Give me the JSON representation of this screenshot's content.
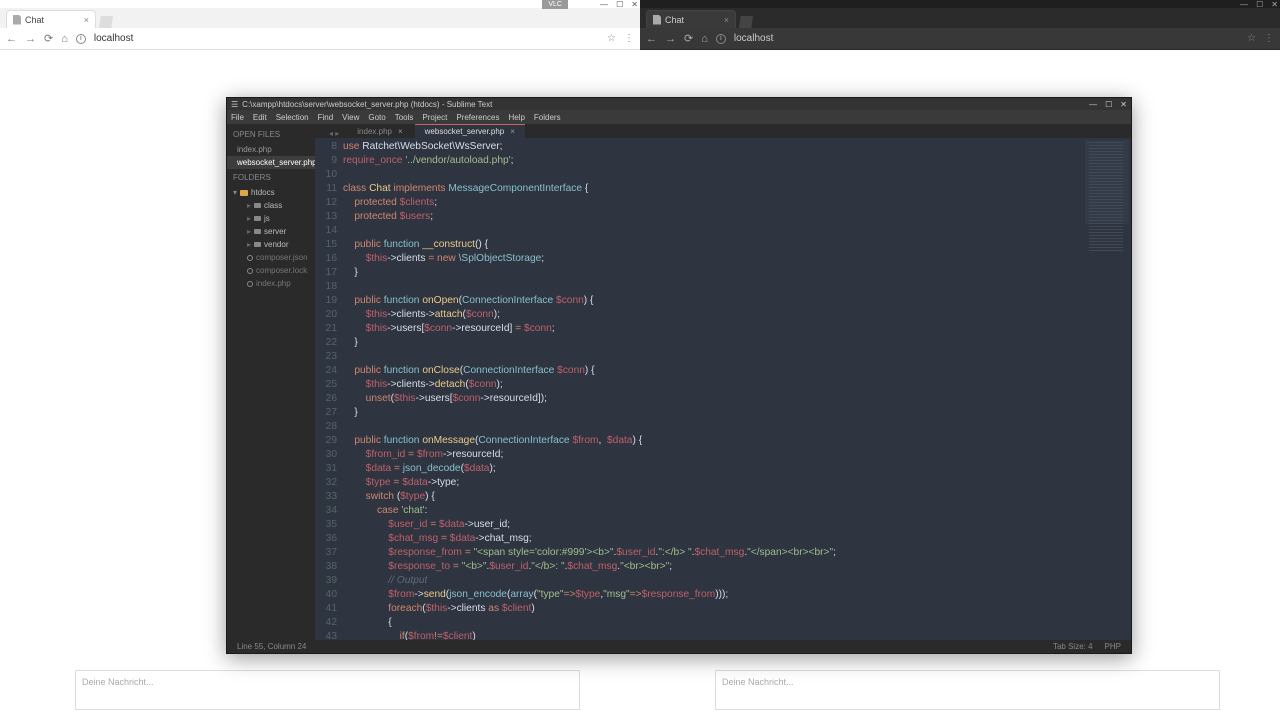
{
  "browserLeft": {
    "tabTitle": "Chat",
    "url": "localhost",
    "vscLabel": "VLC",
    "chatPlaceholder": "Deine Nachricht..."
  },
  "browserRight": {
    "tabTitle": "Chat",
    "url": "localhost",
    "chatPlaceholder": "Deine Nachricht..."
  },
  "editor": {
    "titlebar": "C:\\xampp\\htdocs\\server\\websocket_server.php (htdocs) - Sublime Text",
    "menu": [
      "File",
      "Edit",
      "Selection",
      "Find",
      "View",
      "Goto",
      "Tools",
      "Project",
      "Preferences",
      "Help",
      "Folders"
    ],
    "sidebar": {
      "openFiles": "OPEN FILES",
      "files": [
        "index.php",
        "websocket_server.php"
      ],
      "foldersLabel": "FOLDERS",
      "root": "htdocs",
      "subfolders": [
        "class",
        "js",
        "server",
        "vendor"
      ],
      "loosefiles": [
        "composer.json",
        "composer.lock",
        "index.php"
      ]
    },
    "tabs": [
      "index.php",
      "websocket_server.php"
    ],
    "status": {
      "left": "Line 55, Column 24",
      "tab": "Tab Size: 4",
      "lang": "PHP"
    },
    "lineStart": 8,
    "code": [
      {
        "indent": 0,
        "tokens": [
          [
            "k-orange",
            "use"
          ],
          [
            "",
            " Ratchet\\WebSocket\\WsServer"
          ],
          [
            "punct",
            ";"
          ]
        ]
      },
      {
        "indent": 0,
        "tokens": [
          [
            "k-red",
            "require_once"
          ],
          [
            "",
            " "
          ],
          [
            "k-green",
            "'../vendor/autoload.php'"
          ],
          [
            "punct",
            ";"
          ]
        ]
      },
      {
        "indent": 0,
        "tokens": []
      },
      {
        "indent": 0,
        "tokens": [
          [
            "k-orange",
            "class"
          ],
          [
            "",
            " "
          ],
          [
            "k-yellow",
            "Chat"
          ],
          [
            "",
            " "
          ],
          [
            "k-orange",
            "implements"
          ],
          [
            "",
            " "
          ],
          [
            "k-cyan",
            "MessageComponentInterface"
          ],
          [
            "",
            " "
          ],
          [
            "punct",
            "{"
          ]
        ]
      },
      {
        "indent": 1,
        "tokens": [
          [
            "k-orange",
            "protected"
          ],
          [
            "",
            " "
          ],
          [
            "k-red",
            "$clients"
          ],
          [
            "punct",
            ";"
          ]
        ]
      },
      {
        "indent": 1,
        "tokens": [
          [
            "k-orange",
            "protected"
          ],
          [
            "",
            " "
          ],
          [
            "k-red",
            "$users"
          ],
          [
            "punct",
            ";"
          ]
        ]
      },
      {
        "indent": 0,
        "tokens": []
      },
      {
        "indent": 1,
        "tokens": [
          [
            "k-orange",
            "public"
          ],
          [
            "",
            " "
          ],
          [
            "k-cyan",
            "function"
          ],
          [
            "",
            " "
          ],
          [
            "k-yellow",
            "__construct"
          ],
          [
            "punct",
            "() {"
          ]
        ]
      },
      {
        "indent": 2,
        "tokens": [
          [
            "k-red",
            "$this"
          ],
          [
            "punct",
            "->"
          ],
          [
            "",
            "clients"
          ],
          [
            "",
            " "
          ],
          [
            "k-orange",
            "="
          ],
          [
            "",
            " "
          ],
          [
            "k-orange",
            "new"
          ],
          [
            "",
            " "
          ],
          [
            "k-cyan",
            "\\SplObjectStorage"
          ],
          [
            "punct",
            ";"
          ]
        ]
      },
      {
        "indent": 1,
        "tokens": [
          [
            "punct",
            "}"
          ]
        ]
      },
      {
        "indent": 0,
        "tokens": []
      },
      {
        "indent": 1,
        "tokens": [
          [
            "k-orange",
            "public"
          ],
          [
            "",
            " "
          ],
          [
            "k-cyan",
            "function"
          ],
          [
            "",
            " "
          ],
          [
            "k-yellow",
            "onOpen"
          ],
          [
            "punct",
            "("
          ],
          [
            "k-cyan",
            "ConnectionInterface"
          ],
          [
            "",
            " "
          ],
          [
            "k-red",
            "$conn"
          ],
          [
            "punct",
            ") {"
          ]
        ]
      },
      {
        "indent": 2,
        "tokens": [
          [
            "k-red",
            "$this"
          ],
          [
            "punct",
            "->"
          ],
          [
            "",
            "clients"
          ],
          [
            "punct",
            "->"
          ],
          [
            "k-yellow",
            "attach"
          ],
          [
            "punct",
            "("
          ],
          [
            "k-red",
            "$conn"
          ],
          [
            "punct",
            ");"
          ]
        ]
      },
      {
        "indent": 2,
        "tokens": [
          [
            "k-red",
            "$this"
          ],
          [
            "punct",
            "->"
          ],
          [
            "",
            "users"
          ],
          [
            "punct",
            "["
          ],
          [
            "k-red",
            "$conn"
          ],
          [
            "punct",
            "->"
          ],
          [
            "",
            "resourceId"
          ],
          [
            "punct",
            "]"
          ],
          [
            "",
            " "
          ],
          [
            "k-orange",
            "="
          ],
          [
            "",
            " "
          ],
          [
            "k-red",
            "$conn"
          ],
          [
            "punct",
            ";"
          ]
        ]
      },
      {
        "indent": 1,
        "tokens": [
          [
            "punct",
            "}"
          ]
        ]
      },
      {
        "indent": 0,
        "tokens": []
      },
      {
        "indent": 1,
        "tokens": [
          [
            "k-orange",
            "public"
          ],
          [
            "",
            " "
          ],
          [
            "k-cyan",
            "function"
          ],
          [
            "",
            " "
          ],
          [
            "k-yellow",
            "onClose"
          ],
          [
            "punct",
            "("
          ],
          [
            "k-cyan",
            "ConnectionInterface"
          ],
          [
            "",
            " "
          ],
          [
            "k-red",
            "$conn"
          ],
          [
            "punct",
            ") {"
          ]
        ]
      },
      {
        "indent": 2,
        "tokens": [
          [
            "k-red",
            "$this"
          ],
          [
            "punct",
            "->"
          ],
          [
            "",
            "clients"
          ],
          [
            "punct",
            "->"
          ],
          [
            "k-yellow",
            "detach"
          ],
          [
            "punct",
            "("
          ],
          [
            "k-red",
            "$conn"
          ],
          [
            "punct",
            ");"
          ]
        ]
      },
      {
        "indent": 2,
        "tokens": [
          [
            "k-orange",
            "unset"
          ],
          [
            "punct",
            "("
          ],
          [
            "k-red",
            "$this"
          ],
          [
            "punct",
            "->"
          ],
          [
            "",
            "users"
          ],
          [
            "punct",
            "["
          ],
          [
            "k-red",
            "$conn"
          ],
          [
            "punct",
            "->"
          ],
          [
            "",
            "resourceId"
          ],
          [
            "punct",
            "]);"
          ]
        ]
      },
      {
        "indent": 1,
        "tokens": [
          [
            "punct",
            "}"
          ]
        ]
      },
      {
        "indent": 0,
        "tokens": []
      },
      {
        "indent": 1,
        "tokens": [
          [
            "k-orange",
            "public"
          ],
          [
            "",
            " "
          ],
          [
            "k-cyan",
            "function"
          ],
          [
            "",
            " "
          ],
          [
            "k-yellow",
            "onMessage"
          ],
          [
            "punct",
            "("
          ],
          [
            "k-cyan",
            "ConnectionInterface"
          ],
          [
            "",
            " "
          ],
          [
            "k-red",
            "$from"
          ],
          [
            "punct",
            ",  "
          ],
          [
            "k-red",
            "$data"
          ],
          [
            "punct",
            ") {"
          ]
        ]
      },
      {
        "indent": 2,
        "tokens": [
          [
            "k-red",
            "$from_id"
          ],
          [
            "",
            " "
          ],
          [
            "k-orange",
            "="
          ],
          [
            "",
            " "
          ],
          [
            "k-red",
            "$from"
          ],
          [
            "punct",
            "->"
          ],
          [
            "",
            "resourceId"
          ],
          [
            "punct",
            ";"
          ]
        ]
      },
      {
        "indent": 2,
        "tokens": [
          [
            "k-red",
            "$data"
          ],
          [
            "",
            " "
          ],
          [
            "k-orange",
            "="
          ],
          [
            "",
            " "
          ],
          [
            "k-cyan",
            "json_decode"
          ],
          [
            "punct",
            "("
          ],
          [
            "k-red",
            "$data"
          ],
          [
            "punct",
            ");"
          ]
        ]
      },
      {
        "indent": 2,
        "tokens": [
          [
            "k-red",
            "$type"
          ],
          [
            "",
            " "
          ],
          [
            "k-orange",
            "="
          ],
          [
            "",
            " "
          ],
          [
            "k-red",
            "$data"
          ],
          [
            "punct",
            "->"
          ],
          [
            "",
            "type"
          ],
          [
            "punct",
            ";"
          ]
        ]
      },
      {
        "indent": 2,
        "tokens": [
          [
            "k-orange",
            "switch"
          ],
          [
            "",
            " "
          ],
          [
            "punct",
            "("
          ],
          [
            "k-red",
            "$type"
          ],
          [
            "punct",
            ") {"
          ]
        ]
      },
      {
        "indent": 3,
        "tokens": [
          [
            "k-orange",
            "case"
          ],
          [
            "",
            " "
          ],
          [
            "k-green",
            "'chat'"
          ],
          [
            "punct",
            ":"
          ]
        ]
      },
      {
        "indent": 4,
        "tokens": [
          [
            "k-red",
            "$user_id"
          ],
          [
            "",
            " "
          ],
          [
            "k-orange",
            "="
          ],
          [
            "",
            " "
          ],
          [
            "k-red",
            "$data"
          ],
          [
            "punct",
            "->"
          ],
          [
            "",
            "user_id"
          ],
          [
            "punct",
            ";"
          ]
        ]
      },
      {
        "indent": 4,
        "tokens": [
          [
            "k-red",
            "$chat_msg"
          ],
          [
            "",
            " "
          ],
          [
            "k-orange",
            "="
          ],
          [
            "",
            " "
          ],
          [
            "k-red",
            "$data"
          ],
          [
            "punct",
            "->"
          ],
          [
            "",
            "chat_msg"
          ],
          [
            "punct",
            ";"
          ]
        ]
      },
      {
        "indent": 4,
        "tokens": [
          [
            "k-red",
            "$response_from"
          ],
          [
            "",
            " "
          ],
          [
            "k-orange",
            "="
          ],
          [
            "",
            " "
          ],
          [
            "k-green",
            "\"<span style='color:#999'><b>\""
          ],
          [
            "punct",
            "."
          ],
          [
            "k-red",
            "$user_id"
          ],
          [
            "punct",
            "."
          ],
          [
            "k-green",
            "\":</b> \""
          ],
          [
            "punct",
            "."
          ],
          [
            "k-red",
            "$chat_msg"
          ],
          [
            "punct",
            "."
          ],
          [
            "k-green",
            "\"</span><br><br>\""
          ],
          [
            "punct",
            ";"
          ]
        ]
      },
      {
        "indent": 4,
        "tokens": [
          [
            "k-red",
            "$response_to"
          ],
          [
            "",
            " "
          ],
          [
            "k-orange",
            "="
          ],
          [
            "",
            " "
          ],
          [
            "k-green",
            "\"<b>\""
          ],
          [
            "punct",
            "."
          ],
          [
            "k-red",
            "$user_id"
          ],
          [
            "punct",
            "."
          ],
          [
            "k-green",
            "\"</b>: \""
          ],
          [
            "punct",
            "."
          ],
          [
            "k-red",
            "$chat_msg"
          ],
          [
            "punct",
            "."
          ],
          [
            "k-green",
            "\"<br><br>\""
          ],
          [
            "punct",
            ";"
          ]
        ]
      },
      {
        "indent": 4,
        "tokens": [
          [
            "k-comment",
            "// Output"
          ]
        ]
      },
      {
        "indent": 4,
        "tokens": [
          [
            "k-red",
            "$from"
          ],
          [
            "punct",
            "->"
          ],
          [
            "k-yellow",
            "send"
          ],
          [
            "punct",
            "("
          ],
          [
            "k-cyan",
            "json_encode"
          ],
          [
            "punct",
            "("
          ],
          [
            "k-cyan",
            "array"
          ],
          [
            "punct",
            "("
          ],
          [
            "k-green",
            "\"type\""
          ],
          [
            "k-orange",
            "=>"
          ],
          [
            "k-red",
            "$type"
          ],
          [
            "punct",
            ","
          ],
          [
            "k-green",
            "\"msg\""
          ],
          [
            "k-orange",
            "=>"
          ],
          [
            "k-red",
            "$response_from"
          ],
          [
            "punct",
            ")));"
          ]
        ]
      },
      {
        "indent": 4,
        "tokens": [
          [
            "k-orange",
            "foreach"
          ],
          [
            "punct",
            "("
          ],
          [
            "k-red",
            "$this"
          ],
          [
            "punct",
            "->"
          ],
          [
            "",
            "clients"
          ],
          [
            "",
            " "
          ],
          [
            "k-orange",
            "as"
          ],
          [
            "",
            " "
          ],
          [
            "k-red",
            "$client"
          ],
          [
            "punct",
            ")"
          ]
        ]
      },
      {
        "indent": 4,
        "tokens": [
          [
            "punct",
            "{"
          ]
        ]
      },
      {
        "indent": 5,
        "tokens": [
          [
            "k-orange",
            "if"
          ],
          [
            "punct",
            "("
          ],
          [
            "k-red",
            "$from"
          ],
          [
            "k-orange",
            "!="
          ],
          [
            "k-red",
            "$client"
          ],
          [
            "punct",
            ")"
          ]
        ]
      }
    ]
  }
}
